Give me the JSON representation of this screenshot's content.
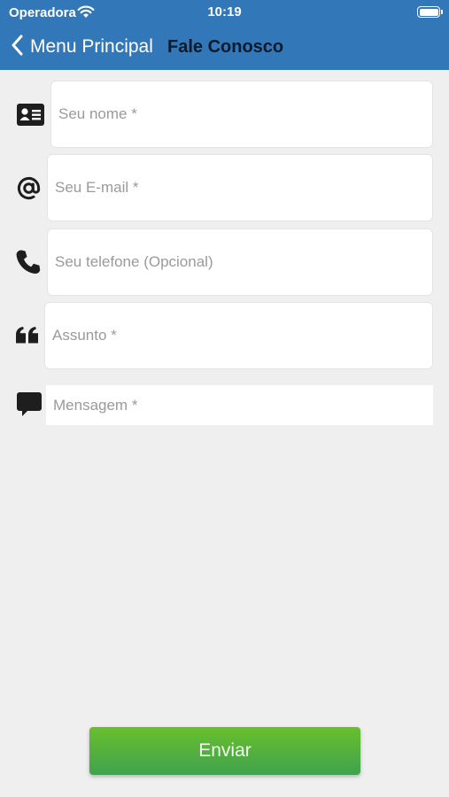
{
  "status_bar": {
    "carrier": "Operadora",
    "time": "10:19"
  },
  "nav": {
    "back_label": "Menu Principal",
    "title": "Fale Conosco"
  },
  "form": {
    "name": {
      "placeholder": "Seu nome *",
      "icon": "contact-card-icon"
    },
    "email": {
      "placeholder": "Seu E-mail *",
      "icon": "at-icon"
    },
    "phone": {
      "placeholder": "Seu telefone (Opcional)",
      "icon": "phone-icon"
    },
    "subject": {
      "placeholder": "Assunto *",
      "icon": "quote-icon"
    },
    "message": {
      "placeholder": "Mensagem *",
      "icon": "speech-bubble-icon"
    }
  },
  "send_label": "Enviar",
  "colors": {
    "header": "#3277b8",
    "background": "#efefef",
    "button_top": "#6abf2c",
    "button_bottom": "#3fa24e"
  }
}
